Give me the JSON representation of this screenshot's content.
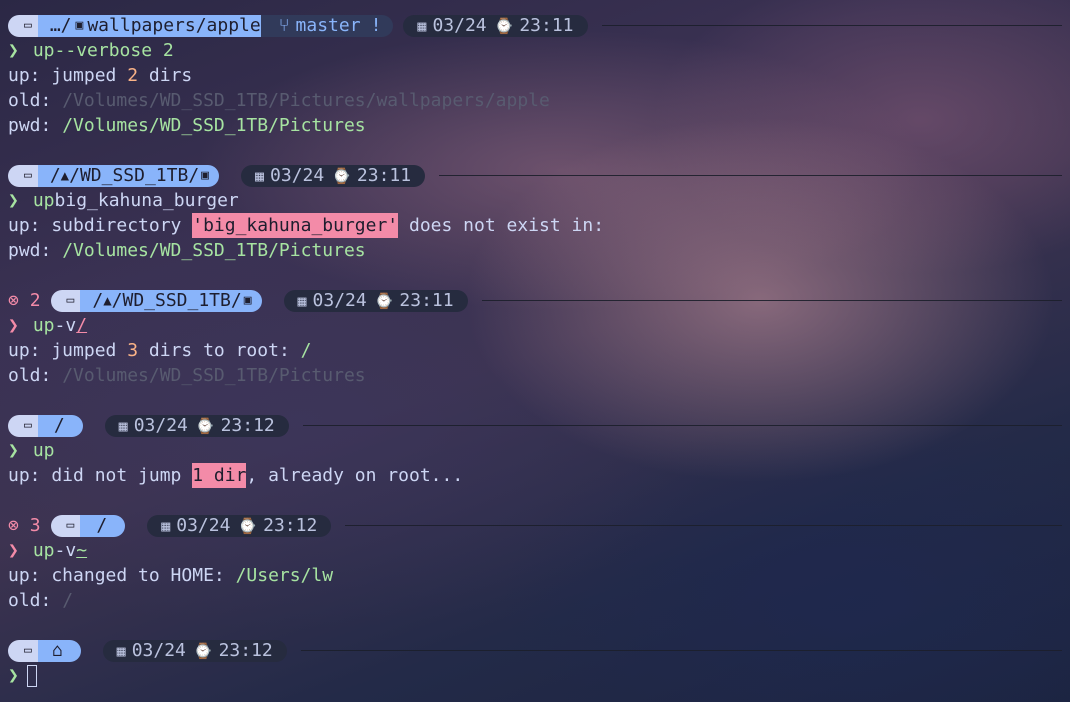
{
  "colors": {
    "os_segment": "#cdd6f4",
    "path_segment": "#89b4fa",
    "git_segment": "#313a5a",
    "time_segment": "#262b3f",
    "prompt_green": "#a6e3a1",
    "error_red": "#f38ba8",
    "number_orange": "#fab387",
    "dim_text": "#585b70"
  },
  "icons": {
    "apple": "",
    "laptop": "💻",
    "calendar": "▦",
    "watch": "⌚",
    "branch": "⑂",
    "home": "⌂",
    "error": "⊗",
    "prompt": "❯",
    "mountain": "▲",
    "image": "▣",
    "folder_img": "▣"
  },
  "blocks": [
    {
      "path_prefix": "…/",
      "path_text": "wallpapers/apple",
      "git_branch": "master",
      "git_status": "!",
      "date": "03/24",
      "time": "23:11",
      "cmd": "up",
      "args": "--verbose 2",
      "out1_label": "up: jumped ",
      "out1_num": "2",
      "out1_rest": " dirs",
      "out2_label": "old: ",
      "out2_value": "/Volumes/WD_SSD_1TB/Pictures/wallpapers/apple",
      "out3_label": "pwd: ",
      "out3_value": "/Volumes/WD_SSD_1TB/Pictures"
    },
    {
      "path_prefix": "/",
      "path_text": "/WD_SSD_1TB/",
      "date": "03/24",
      "time": "23:11",
      "cmd": "up",
      "args": "big_kahuna_burger",
      "out1_label": "up: subdirectory ",
      "out1_hl": "'big_kahuna_burger'",
      "out1_rest": " does not exist in:",
      "out2_label": "pwd: ",
      "out2_value": "/Volumes/WD_SSD_1TB/Pictures"
    },
    {
      "err_code": "2",
      "path_prefix": "/",
      "path_text": "/WD_SSD_1TB/",
      "date": "03/24",
      "time": "23:11",
      "cmd": "up",
      "args_flag": "-v",
      "args_path": "/",
      "out1_label": "up: jumped ",
      "out1_num": "3",
      "out1_rest": " dirs to root: ",
      "out1_path": "/",
      "out2_label": "old: ",
      "out2_value": "/Volumes/WD_SSD_1TB/Pictures"
    },
    {
      "path_text": "/",
      "date": "03/24",
      "time": "23:12",
      "cmd": "up",
      "out1_label": "up: did not jump ",
      "out1_hl": "1 dir",
      "out1_rest": ", already on root..."
    },
    {
      "err_code": "3",
      "path_text": "/",
      "date": "03/24",
      "time": "23:12",
      "cmd": "up",
      "args_flag": "-v",
      "args_path": "~",
      "out1_label": "up: changed to HOME: ",
      "out1_value": "/Users/lw",
      "out2_label": "old: ",
      "out2_value": "/"
    },
    {
      "date": "03/24",
      "time": "23:12"
    }
  ]
}
